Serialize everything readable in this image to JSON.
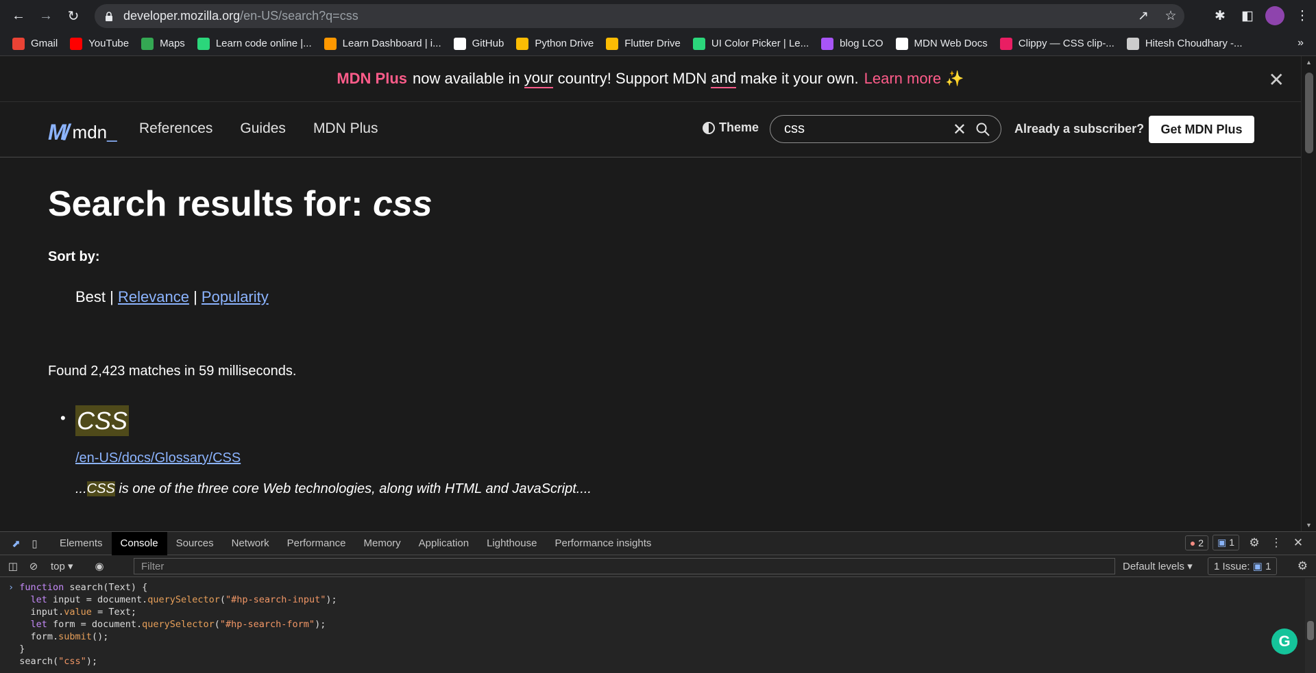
{
  "browser": {
    "url_host": "developer.mozilla.org",
    "url_path": "/en-US/search?q=css",
    "bookmarks": [
      {
        "label": "Gmail",
        "icon": "gmail-icon",
        "color": "#ea4335"
      },
      {
        "label": "YouTube",
        "icon": "youtube-icon",
        "color": "#ff0000"
      },
      {
        "label": "Maps",
        "icon": "maps-icon",
        "color": "#34a853"
      },
      {
        "label": "Learn code online |...",
        "icon": "learncode-icon",
        "color": "#2bd67b"
      },
      {
        "label": "Learn Dashboard | i...",
        "icon": "dashboard-icon",
        "color": "#ff9800"
      },
      {
        "label": "GitHub",
        "icon": "github-icon",
        "color": "#ffffff"
      },
      {
        "label": "Python Drive",
        "icon": "drive-icon",
        "color": "#fbbc04"
      },
      {
        "label": "Flutter Drive",
        "icon": "drive-icon",
        "color": "#fbbc04"
      },
      {
        "label": "UI Color Picker | Le...",
        "icon": "learncode-icon",
        "color": "#2bd67b"
      },
      {
        "label": "blog LCO",
        "icon": "blog-icon",
        "color": "#a855f7"
      },
      {
        "label": "MDN Web Docs",
        "icon": "mdn-icon",
        "color": "#ffffff"
      },
      {
        "label": "Clippy — CSS clip-...",
        "icon": "clippy-icon",
        "color": "#e91e63"
      },
      {
        "label": "Hitesh Choudhary -...",
        "icon": "page-icon",
        "color": "#cccccc"
      }
    ],
    "more": "»"
  },
  "banner": {
    "brand": "MDN Plus",
    "text_1": "now available in",
    "your": "your",
    "text_2": "country! Support MDN",
    "and": "and",
    "text_3": "make it your own.",
    "learn": "Learn more",
    "sparkle": "✨"
  },
  "header": {
    "logo_mark": "M",
    "logo_word": "mdn",
    "logo_underscore": "_",
    "nav": [
      "References",
      "Guides",
      "MDN Plus"
    ],
    "theme": "Theme",
    "search_value": "css",
    "subscriber": "Already a subscriber?",
    "cta": "Get MDN Plus"
  },
  "main": {
    "title_prefix": "Search results for: ",
    "title_query": "css",
    "sort_label": "Sort by:",
    "sort_best": "Best",
    "sort_sep": "|",
    "sort_relevance": "Relevance",
    "sort_popularity": "Popularity",
    "found": "Found 2,423 matches in 59 milliseconds.",
    "results": [
      {
        "title": "CSS",
        "url": "/en-US/docs/Glossary/CSS",
        "snippet_prefix": "...",
        "snippet_hl": "CSS",
        "snippet_rest": " is one of the three core Web technologies, along with HTML and JavaScript...."
      }
    ]
  },
  "devtools": {
    "tabs": [
      "Elements",
      "Console",
      "Sources",
      "Network",
      "Performance",
      "Memory",
      "Application",
      "Lighthouse",
      "Performance insights"
    ],
    "active_tab": "Console",
    "errors": "2",
    "messages": "1",
    "context": "top",
    "filter_placeholder": "Filter",
    "levels": "Default levels",
    "issues_label": "1 Issue:",
    "issues_count": "1",
    "code": {
      "l1_kw": "function",
      "l1_rest": " search(Text) {",
      "l2_kw": "let",
      "l2_a": " input = document.",
      "l2_prop": "querySelector",
      "l2_b": "(",
      "l2_str": "\"#hp-search-input\"",
      "l2_c": ");",
      "l3_a": "input.",
      "l3_prop": "value",
      "l3_b": " = Text;",
      "l4_kw": "let",
      "l4_a": " form = document.",
      "l4_prop": "querySelector",
      "l4_b": "(",
      "l4_str": "\"#hp-search-form\"",
      "l4_c": ");",
      "l5_a": "form.",
      "l5_prop": "submit",
      "l5_b": "();",
      "l6": "}",
      "l7_a": "search(",
      "l7_str": "\"css\"",
      "l7_b": ");"
    }
  }
}
